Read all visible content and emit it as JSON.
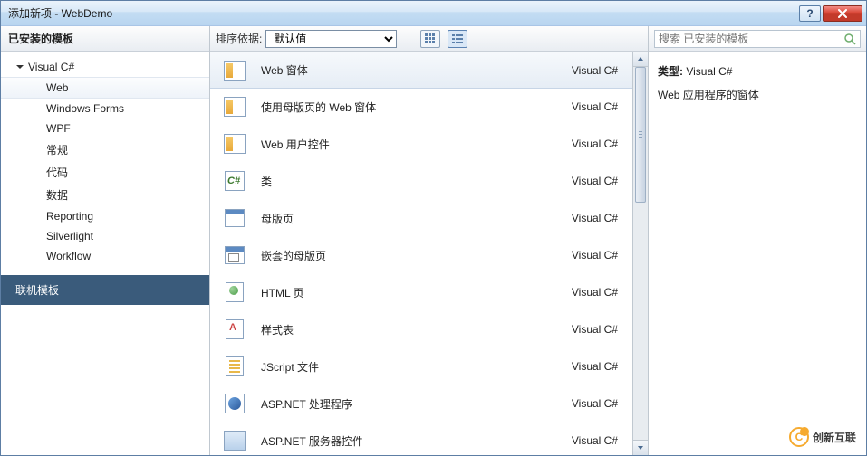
{
  "window": {
    "title": "添加新项 - WebDemo",
    "help": "?",
    "close": "×"
  },
  "left": {
    "header": "已安装的模板",
    "root": "Visual C#",
    "items": [
      "Web",
      "Windows Forms",
      "WPF",
      "常规",
      "代码",
      "数据",
      "Reporting",
      "Silverlight",
      "Workflow"
    ],
    "selected_index": 0,
    "online": "联机模板"
  },
  "toolbar": {
    "sort_label": "排序依据:",
    "sort_value": "默认值"
  },
  "templates": [
    {
      "name": "Web 窗体",
      "lang": "Visual C#",
      "icon": "ic-box",
      "selected": true
    },
    {
      "name": "使用母版页的 Web 窗体",
      "lang": "Visual C#",
      "icon": "ic-box"
    },
    {
      "name": "Web 用户控件",
      "lang": "Visual C#",
      "icon": "ic-box"
    },
    {
      "name": "类",
      "lang": "Visual C#",
      "icon": "ic-green"
    },
    {
      "name": "母版页",
      "lang": "Visual C#",
      "icon": "ic-win"
    },
    {
      "name": "嵌套的母版页",
      "lang": "Visual C#",
      "icon": "ic-nest"
    },
    {
      "name": "HTML 页",
      "lang": "Visual C#",
      "icon": "ic-html"
    },
    {
      "name": "样式表",
      "lang": "Visual C#",
      "icon": "ic-css"
    },
    {
      "name": "JScript 文件",
      "lang": "Visual C#",
      "icon": "ic-js"
    },
    {
      "name": "ASP.NET 处理程序",
      "lang": "Visual C#",
      "icon": "ic-aspx"
    },
    {
      "name": "ASP.NET 服务器控件",
      "lang": "Visual C#",
      "icon": "ic-srv"
    }
  ],
  "search": {
    "placeholder": "搜索 已安装的模板"
  },
  "details": {
    "type_label": "类型:",
    "type_value": "Visual C#",
    "description": "Web 应用程序的窗体"
  },
  "watermark": "创新互联"
}
